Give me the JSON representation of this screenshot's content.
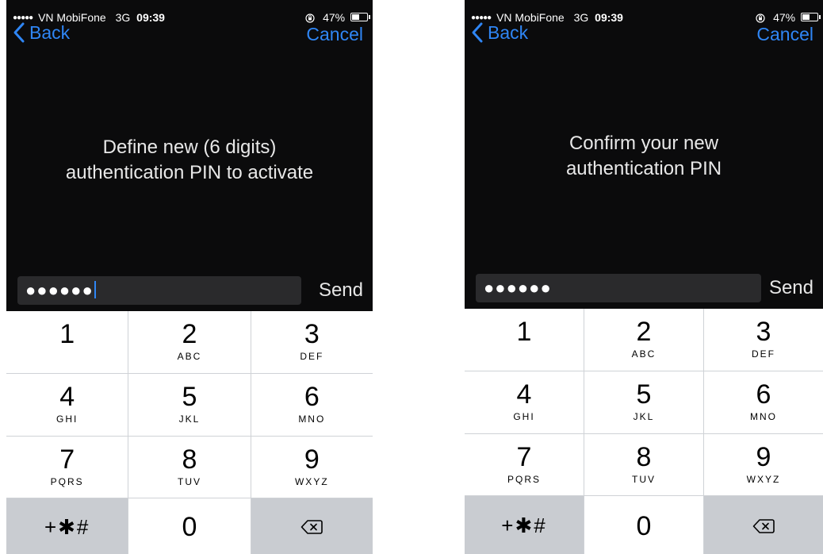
{
  "screens": [
    {
      "status": {
        "carrier": "VN MobiFone",
        "network": "3G",
        "time": "09:39",
        "battery": "47%"
      },
      "nav": {
        "back_label": "Back",
        "cancel_label": "Cancel"
      },
      "prompt": {
        "line1": "Define new (6 digits)",
        "line2": "authentication PIN to activate"
      },
      "pin": {
        "masked_value": "●●●●●●"
      },
      "send_label": "Send"
    },
    {
      "status": {
        "carrier": "VN MobiFone",
        "network": "3G",
        "time": "09:39",
        "battery": "47%"
      },
      "nav": {
        "back_label": "Back",
        "cancel_label": "Cancel"
      },
      "prompt": {
        "line1": "Confirm your new",
        "line2": "authentication PIN"
      },
      "pin": {
        "masked_value": "●●●●●●"
      },
      "send_label": "Send"
    }
  ],
  "keypad": {
    "keys": [
      {
        "digit": "1",
        "letters": ""
      },
      {
        "digit": "2",
        "letters": "ABC"
      },
      {
        "digit": "3",
        "letters": "DEF"
      },
      {
        "digit": "4",
        "letters": "GHI"
      },
      {
        "digit": "5",
        "letters": "JKL"
      },
      {
        "digit": "6",
        "letters": "MNO"
      },
      {
        "digit": "7",
        "letters": "PQRS"
      },
      {
        "digit": "8",
        "letters": "TUV"
      },
      {
        "digit": "9",
        "letters": "WXYZ"
      }
    ],
    "symbols_label": "+✱#",
    "zero_label": "0"
  },
  "colors": {
    "accent": "#2f86f5",
    "screen_bg": "#0b0b0c",
    "key_gray": "#c9ccd1"
  },
  "icons": {
    "back": "chevron-left-icon",
    "delete": "backspace-icon",
    "rotation_lock": "rotation-lock-icon",
    "battery": "battery-icon"
  }
}
